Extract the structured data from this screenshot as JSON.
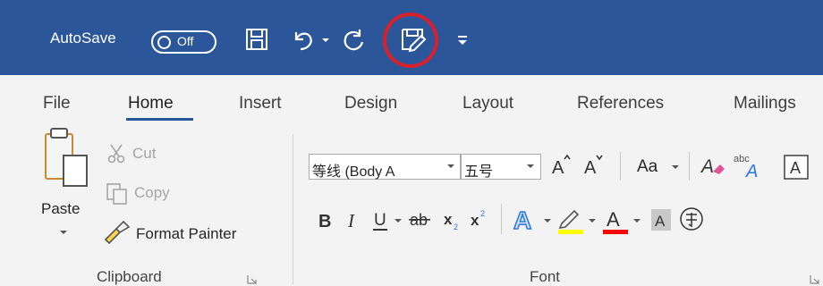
{
  "qat": {
    "autosave_label": "AutoSave",
    "autosave_state": "Off"
  },
  "tabs": [
    {
      "label": "File"
    },
    {
      "label": "Home",
      "active": true
    },
    {
      "label": "Insert"
    },
    {
      "label": "Design"
    },
    {
      "label": "Layout"
    },
    {
      "label": "References"
    },
    {
      "label": "Mailings"
    }
  ],
  "clipboard": {
    "paste_label": "Paste",
    "cut_label": "Cut",
    "copy_label": "Copy",
    "format_painter_label": "Format Painter",
    "group_label": "Clipboard"
  },
  "font": {
    "font_name": "等线 (Body A",
    "font_size": "五号",
    "change_case_label": "Aa",
    "phonetic_label": "abc",
    "group_label": "Font"
  },
  "icons": {
    "highlight_ring_color": "#d9202a",
    "title_bar_color": "#2b579a",
    "text_highlight_color": "#ffff00",
    "font_color": "#ff0000",
    "text_effects_color": "#2b78e4"
  }
}
